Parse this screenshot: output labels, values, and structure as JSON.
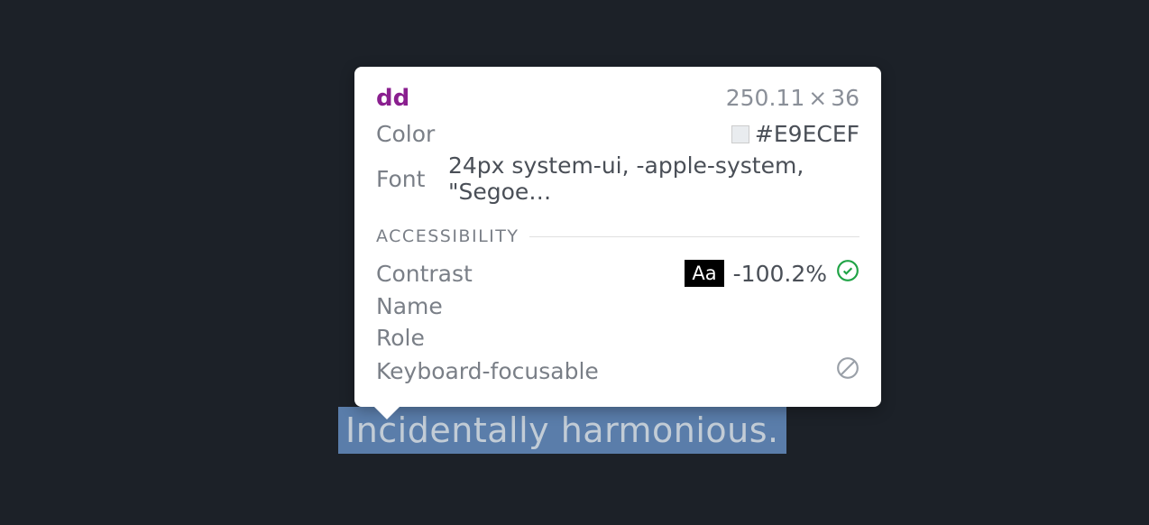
{
  "inspected": {
    "text": "Incidentally harmonious."
  },
  "tooltip": {
    "tag": "dd",
    "dimensions": {
      "width": "250.11",
      "times": "×",
      "height": "36"
    },
    "properties": {
      "color_label": "Color",
      "color_value": "#E9ECEF",
      "font_label": "Font",
      "font_value": "24px system-ui, -apple-system, \"Segoe…"
    },
    "accessibility": {
      "section_title": "ACCESSIBILITY",
      "contrast_label": "Contrast",
      "contrast_badge": "Aa",
      "contrast_value": "-100.2%",
      "name_label": "Name",
      "role_label": "Role",
      "keyboard_label": "Keyboard-focusable"
    }
  }
}
